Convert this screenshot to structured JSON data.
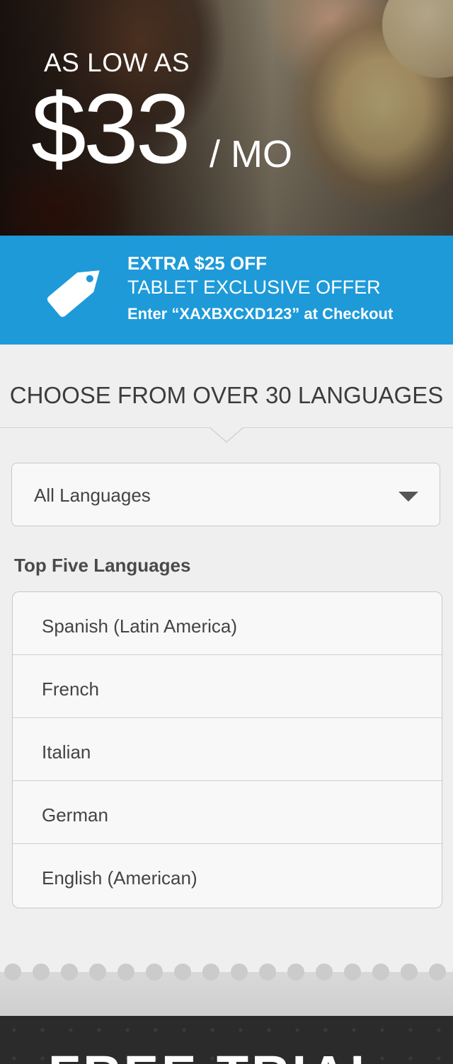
{
  "hero": {
    "as_low_as": "AS LOW AS",
    "price": "$33",
    "per": "/ MO"
  },
  "promo": {
    "line1": "EXTRA $25 OFF",
    "line2": "TABLET EXCLUSIVE OFFER",
    "line3": "Enter “XAXBXCXD123” at Checkout",
    "icon": "price-tag-icon",
    "color": "#1e9ad9"
  },
  "choose": {
    "title": "CHOOSE FROM OVER 30 LANGUAGES"
  },
  "language_select": {
    "value": "All Languages",
    "icon": "caret-down-icon"
  },
  "top_five": {
    "label": "Top Five Languages",
    "items": [
      {
        "label": "Spanish (Latin America)"
      },
      {
        "label": "French"
      },
      {
        "label": "Italian"
      },
      {
        "label": "German"
      },
      {
        "label": "English (American)"
      }
    ]
  },
  "cta": {
    "label": "FREE TRIAL"
  }
}
